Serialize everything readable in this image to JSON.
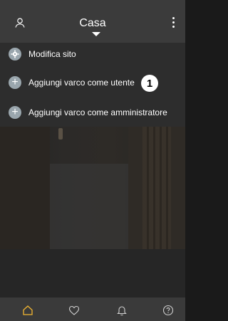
{
  "header": {
    "title": "Casa",
    "icons": {
      "left": "user-icon",
      "right": "more-vert-icon",
      "title_chevron": "triangle-down-icon"
    }
  },
  "menu": {
    "items": [
      {
        "label": "Modifica sito",
        "icon": "gear-icon"
      },
      {
        "label": "Aggiungi varco come utente",
        "icon": "plus-icon"
      },
      {
        "label": "Aggiungi varco come amministratore",
        "icon": "plus-icon"
      }
    ],
    "step_badge": "1"
  },
  "bottom_nav": {
    "tabs": [
      {
        "name": "home",
        "icon": "home-icon",
        "active": true
      },
      {
        "name": "favorites",
        "icon": "heart-icon",
        "active": false
      },
      {
        "name": "notifications",
        "icon": "bell-icon",
        "active": false
      },
      {
        "name": "help",
        "icon": "help-icon",
        "active": false
      }
    ]
  },
  "colors": {
    "accent": "#F2B632",
    "topbar": "#3B3B3B",
    "menu_bg": "#2D2D2D",
    "icon_circle": "#9AA6AD"
  }
}
